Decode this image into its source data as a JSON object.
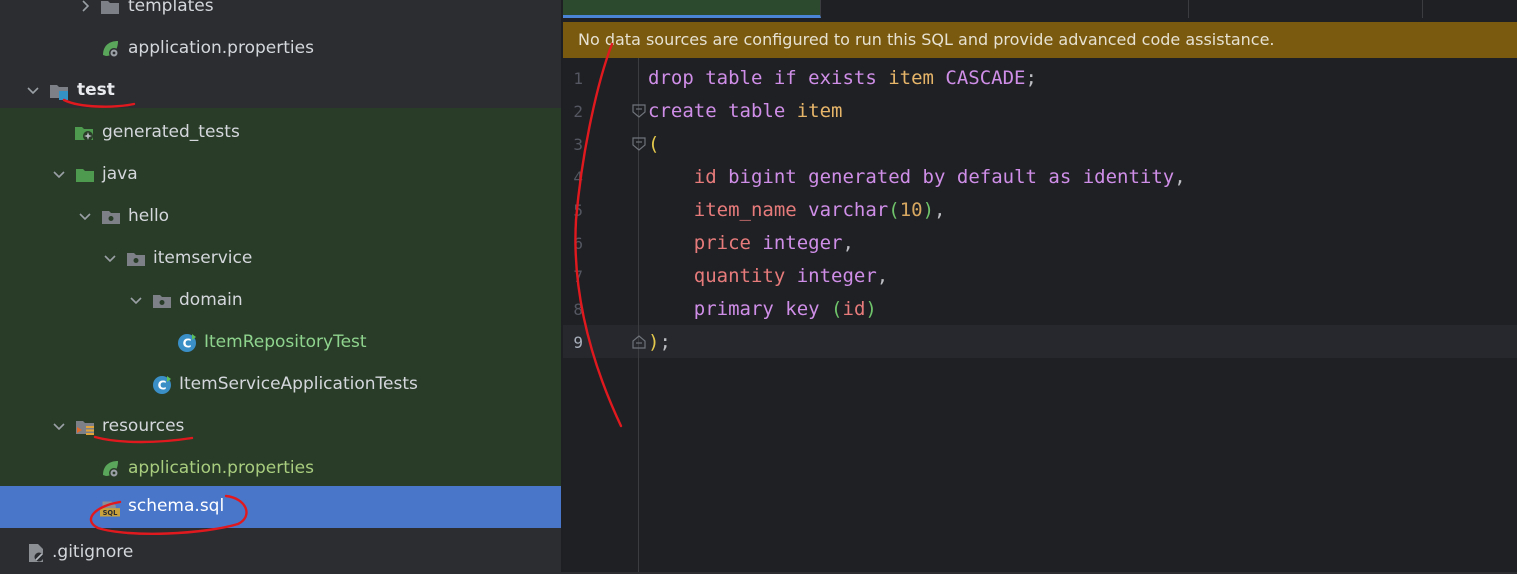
{
  "tree": {
    "items": [
      {
        "label": "templates"
      },
      {
        "label": "application.properties"
      },
      {
        "label": "test"
      },
      {
        "label": "generated_tests"
      },
      {
        "label": "java"
      },
      {
        "label": "hello"
      },
      {
        "label": "itemservice"
      },
      {
        "label": "domain"
      },
      {
        "label": "ItemRepositoryTest"
      },
      {
        "label": "ItemServiceApplicationTests"
      },
      {
        "label": "resources"
      },
      {
        "label": "application.properties"
      },
      {
        "label": "schema.sql"
      },
      {
        "label": ".gitignore"
      }
    ]
  },
  "editor": {
    "banner": "No data sources are configured to run this SQL and provide advanced code assistance.",
    "line_numbers": [
      "1",
      "2",
      "3",
      "4",
      "5",
      "6",
      "7",
      "8",
      "9"
    ],
    "code": {
      "l1": {
        "kw1": "drop table if exists ",
        "id": "item",
        "kw2": " CASCADE",
        "end": ";"
      },
      "l2": {
        "kw": "create table ",
        "id": "item"
      },
      "l3": {
        "p": "("
      },
      "l4": {
        "col": "id",
        "kw": " bigint generated by default as identity",
        "end": ","
      },
      "l5": {
        "col": "item_name",
        "kw": " varchar",
        "p1": "(",
        "num": "10",
        "p2": ")",
        "end": ","
      },
      "l6": {
        "col": "price",
        "kw": " integer",
        "end": ","
      },
      "l7": {
        "col": "quantity",
        "kw": " integer",
        "end": ","
      },
      "l8": {
        "kw": "primary key ",
        "p1": "(",
        "col": "id",
        "p2": ")"
      },
      "l9": {
        "p": ")",
        "end": ";"
      }
    }
  },
  "colors": {
    "selection": "#4a76c9",
    "banner": "#7a5a0e",
    "keyword": "#cf8ee7",
    "annotation": "#e0191f"
  }
}
